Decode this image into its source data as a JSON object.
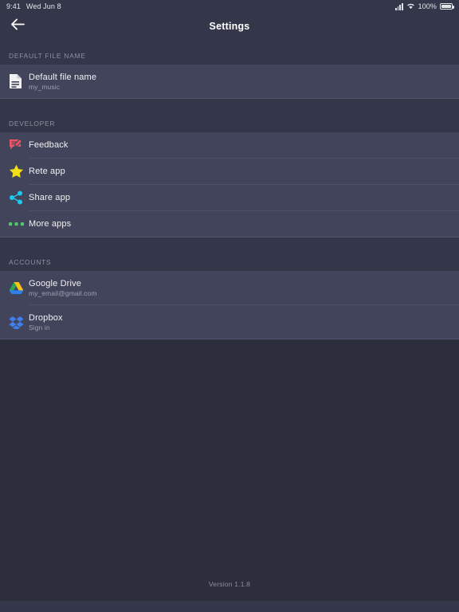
{
  "status_bar": {
    "time": "9:41",
    "date": "Wed Jun 8",
    "battery_percent": "100%",
    "signal_icon": "cellular-signal-icon",
    "wifi_icon": "wifi-icon",
    "battery_icon": "battery-full-icon"
  },
  "toolbar": {
    "title": "Settings",
    "back_icon": "back-arrow-icon"
  },
  "sections": [
    {
      "header": "DEFAULT FILE NAME",
      "rows": [
        {
          "icon": "document-icon",
          "title": "Default file name",
          "subtitle": "my_music"
        }
      ]
    },
    {
      "header": "DEVELOPER",
      "rows": [
        {
          "icon": "feedback-icon",
          "title": "Feedback",
          "subtitle": ""
        },
        {
          "icon": "star-icon",
          "title": "Rete app",
          "subtitle": ""
        },
        {
          "icon": "share-icon",
          "title": "Share app",
          "subtitle": ""
        },
        {
          "icon": "more-apps-icon",
          "title": "More apps",
          "subtitle": ""
        }
      ]
    },
    {
      "header": "ACCOUNTS",
      "rows": [
        {
          "icon": "google-drive-icon",
          "title": "Google Drive",
          "subtitle": "my_email@gmail.com"
        },
        {
          "icon": "dropbox-icon",
          "title": "Dropbox",
          "subtitle": "Sign in"
        }
      ]
    }
  ],
  "footer": {
    "version": "Version 1.1.8"
  },
  "colors": {
    "background": "#2c2e3b",
    "bar": "#34364a",
    "row": "#41445a",
    "divider": "#4c5068",
    "title_text": "#f1f1f4",
    "subtitle_text": "#9fa1b0",
    "section_header_text": "#8e90a0",
    "feedback_red": "#ef5464",
    "star_yellow": "#f2e014",
    "share_cyan": "#1ec8e8",
    "more_green": "#4cc76a",
    "drive_blue": "#2d7ff0",
    "drive_green": "#2aa84f",
    "drive_yellow": "#f6c413",
    "dropbox_blue": "#3f7ff0"
  }
}
